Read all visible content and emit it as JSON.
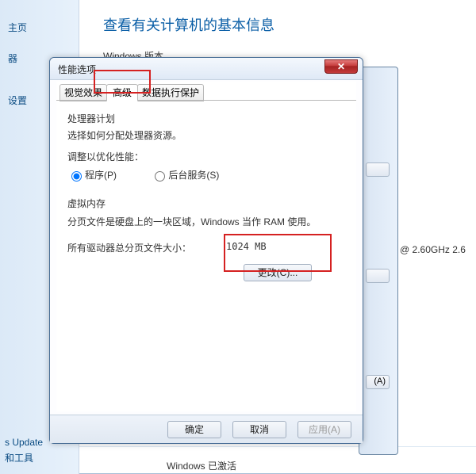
{
  "cp": {
    "sidebar": {
      "items": [
        "主页",
        "器",
        "设置"
      ]
    },
    "heading": "查看有关计算机的基本信息",
    "section_windows_version": "Windows 版本",
    "right_cpu": "@ 2.60GHz  2.6",
    "lower_right_btn_suffix": "(A)",
    "bottom_links": [
      "s Update",
      "和工具"
    ],
    "bottom_status_active": "Windows 已激活"
  },
  "dialog": {
    "title": "性能选项",
    "tabs": {
      "visual": "视觉效果",
      "advanced": "高级",
      "dep": "数据执行保护"
    },
    "processor": {
      "title": "处理器计划",
      "desc": "选择如何分配处理器资源。",
      "optimize_label": "调整以优化性能：",
      "radio_programs": "程序(P)",
      "radio_services": "后台服务(S)"
    },
    "virtual_memory": {
      "title": "虚拟内存",
      "desc": "分页文件是硬盘上的一块区域，Windows 当作 RAM 使用。",
      "size_label": "所有驱动器总分页文件大小：",
      "size_value": "1024 MB",
      "change_btn": "更改(C)..."
    },
    "buttons": {
      "ok": "确定",
      "cancel": "取消",
      "apply": "应用(A)"
    }
  }
}
